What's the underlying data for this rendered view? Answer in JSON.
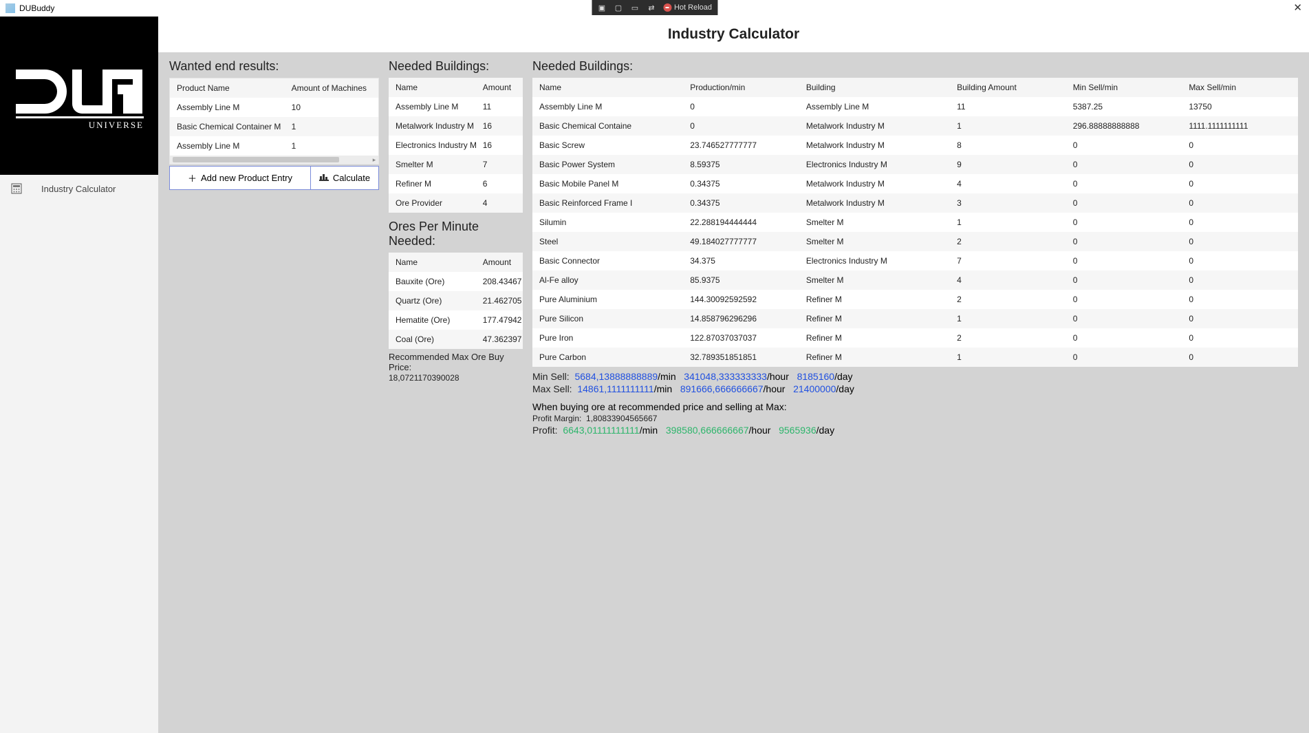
{
  "appTitle": "DUBuddy",
  "hotReload": "Hot Reload",
  "pageTitle": "Industry Calculator",
  "nav": {
    "item1": "Industry Calculator"
  },
  "wanted": {
    "heading": "Wanted end results:",
    "cols": {
      "c1": "Product Name",
      "c2": "Amount of Machines"
    },
    "rows": [
      {
        "name": "Assembly Line M",
        "amount": "10"
      },
      {
        "name": "Basic Chemical Container M",
        "amount": "1"
      },
      {
        "name": "Assembly Line M",
        "amount": "1"
      }
    ],
    "addBtn": "Add new Product Entry",
    "calcBtn": "Calculate"
  },
  "needed1": {
    "heading": "Needed Buildings:",
    "cols": {
      "c1": "Name",
      "c2": "Amount"
    },
    "rows": [
      {
        "name": "Assembly Line M",
        "amount": "11"
      },
      {
        "name": "Metalwork Industry M",
        "amount": "16"
      },
      {
        "name": "Electronics Industry M",
        "amount": "16"
      },
      {
        "name": "Smelter M",
        "amount": "7"
      },
      {
        "name": "Refiner M",
        "amount": "6"
      },
      {
        "name": "Ore Provider",
        "amount": "4"
      }
    ]
  },
  "ores": {
    "heading": "Ores Per Minute Needed:",
    "cols": {
      "c1": "Name",
      "c2": "Amount"
    },
    "rows": [
      {
        "name": "Bauxite (Ore)",
        "amount": "208.43467"
      },
      {
        "name": "Quartz (Ore)",
        "amount": "21.462705"
      },
      {
        "name": "Hematite (Ore)",
        "amount": "177.47942"
      },
      {
        "name": "Coal (Ore)",
        "amount": "47.362397"
      }
    ],
    "recLabel": "Recommended Max Ore Buy Price:",
    "recValue": "18,0721170390028"
  },
  "needed2": {
    "heading": "Needed Buildings:",
    "cols": {
      "c1": "Name",
      "c2": "Production/min",
      "c3": "Building",
      "c4": "Building Amount",
      "c5": "Min Sell/min",
      "c6": "Max Sell/min"
    },
    "rows": [
      {
        "name": "Assembly Line M",
        "prod": "0",
        "building": "Assembly Line M",
        "bamt": "11",
        "min": "5387.25",
        "max": "13750"
      },
      {
        "name": "Basic Chemical Containe",
        "prod": "0",
        "building": "Metalwork Industry M",
        "bamt": "1",
        "min": "296.88888888888",
        "max": "1111.1111111111"
      },
      {
        "name": "Basic Screw",
        "prod": "23.746527777777",
        "building": "Metalwork Industry M",
        "bamt": "8",
        "min": "0",
        "max": "0"
      },
      {
        "name": "Basic Power System",
        "prod": "8.59375",
        "building": "Electronics Industry M",
        "bamt": "9",
        "min": "0",
        "max": "0"
      },
      {
        "name": "Basic Mobile Panel M",
        "prod": "0.34375",
        "building": "Metalwork Industry M",
        "bamt": "4",
        "min": "0",
        "max": "0"
      },
      {
        "name": "Basic Reinforced Frame I",
        "prod": "0.34375",
        "building": "Metalwork Industry M",
        "bamt": "3",
        "min": "0",
        "max": "0"
      },
      {
        "name": "Silumin",
        "prod": "22.288194444444",
        "building": "Smelter M",
        "bamt": "1",
        "min": "0",
        "max": "0"
      },
      {
        "name": "Steel",
        "prod": "49.184027777777",
        "building": "Smelter M",
        "bamt": "2",
        "min": "0",
        "max": "0"
      },
      {
        "name": "Basic Connector",
        "prod": "34.375",
        "building": "Electronics Industry M",
        "bamt": "7",
        "min": "0",
        "max": "0"
      },
      {
        "name": "Al-Fe alloy",
        "prod": "85.9375",
        "building": "Smelter M",
        "bamt": "4",
        "min": "0",
        "max": "0"
      },
      {
        "name": "Pure Aluminium",
        "prod": "144.30092592592",
        "building": "Refiner M",
        "bamt": "2",
        "min": "0",
        "max": "0"
      },
      {
        "name": "Pure Silicon",
        "prod": "14.858796296296",
        "building": "Refiner M",
        "bamt": "1",
        "min": "0",
        "max": "0"
      },
      {
        "name": "Pure Iron",
        "prod": "122.87037037037",
        "building": "Refiner M",
        "bamt": "2",
        "min": "0",
        "max": "0"
      },
      {
        "name": "Pure Carbon",
        "prod": "32.789351851851",
        "building": "Refiner M",
        "bamt": "1",
        "min": "0",
        "max": "0"
      }
    ]
  },
  "summary": {
    "minSellLabel": "Min Sell:",
    "minSell_min": "5684,13888888889",
    "minSell_hour": "341048,333333333",
    "minSell_day": "8185160",
    "maxSellLabel": "Max Sell:",
    "maxSell_min": "14861,1111111111",
    "maxSell_hour": "891666,666666667",
    "maxSell_day": "21400000",
    "whenBuying": "When buying ore at recommended price and selling at Max:",
    "profitMarginLabel": "Profit Margin:",
    "profitMargin": "1,80833904565667",
    "profitLabel": "Profit:",
    "profit_min": "6643,01111111111",
    "profit_hour": "398580,666666667",
    "profit_day": "9565936",
    "unit_min": "/min",
    "unit_hour": "/hour",
    "unit_day": "/day"
  }
}
